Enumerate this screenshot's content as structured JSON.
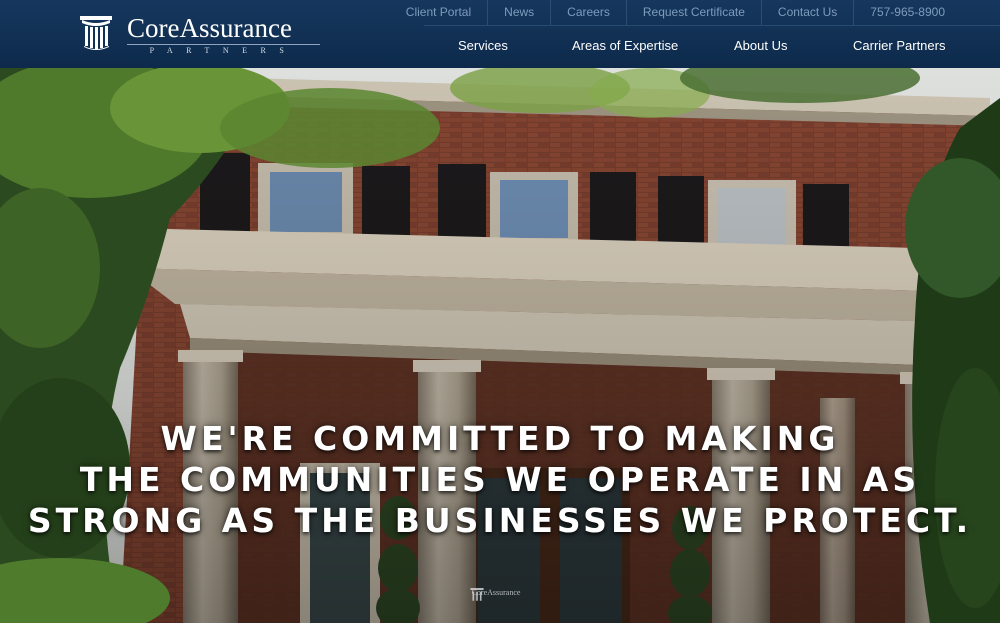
{
  "brand": {
    "name_core": "Core",
    "name_assurance": "Assurance",
    "tagline": "Partners",
    "logo_icon": "column-pillar-icon"
  },
  "utility_nav": [
    {
      "label": "Client Portal"
    },
    {
      "label": "News"
    },
    {
      "label": "Careers"
    },
    {
      "label": "Request Certificate"
    },
    {
      "label": "Contact Us"
    },
    {
      "label": "757-965-8900"
    }
  ],
  "main_nav": [
    {
      "label": "Services"
    },
    {
      "label": "Areas of Expertise"
    },
    {
      "label": "About Us"
    },
    {
      "label": "Carrier Partners"
    }
  ],
  "hero": {
    "headline_lines": [
      "We're committed to making",
      "the communities we operate in as",
      "strong as the businesses we protect."
    ],
    "door_sign": "CoreAssurance"
  },
  "colors": {
    "header_bg": "#0d2a4b",
    "utility_link": "#7f9bbd",
    "nav_link": "#ffffff"
  }
}
